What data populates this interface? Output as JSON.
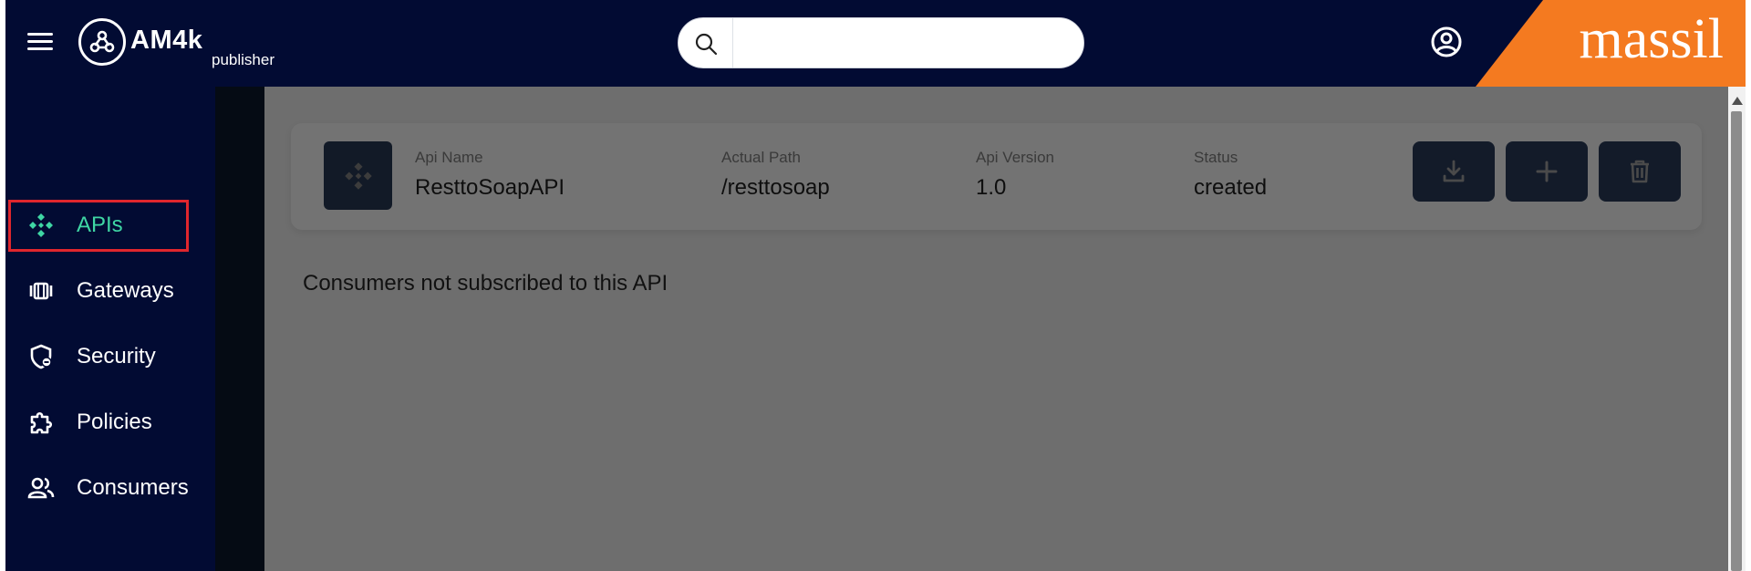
{
  "header": {
    "logo_text": "AM4k",
    "logo_subtitle": "publisher",
    "search": {
      "value": "",
      "placeholder": ""
    },
    "brand_text": "massil"
  },
  "sidebar": {
    "items": [
      {
        "label": "APIs",
        "icon": "apis-icon",
        "active": true
      },
      {
        "label": "Gateways",
        "icon": "gateways-icon",
        "active": false
      },
      {
        "label": "Security",
        "icon": "security-shield-icon",
        "active": false
      },
      {
        "label": "Policies",
        "icon": "policies-puzzle-icon",
        "active": false
      },
      {
        "label": "Consumers",
        "icon": "consumers-icon",
        "active": false
      }
    ]
  },
  "api_card": {
    "name_label": "Api Name",
    "name_value": "ResttoSoapAPI",
    "path_label": "Actual Path",
    "path_value": "/resttosoap",
    "version_label": "Api Version",
    "version_value": "1.0",
    "status_label": "Status",
    "status_value": "created",
    "actions": [
      "download-icon",
      "plus-icon",
      "trash-icon"
    ]
  },
  "notice": "Consumers not subscribed to this API",
  "colors": {
    "header_bg": "#020b33",
    "brand_orange": "#f47a20",
    "active_accent": "#3fd6a4",
    "highlight_outline": "#e0262d",
    "main_overlay": "#6e6e6e"
  }
}
